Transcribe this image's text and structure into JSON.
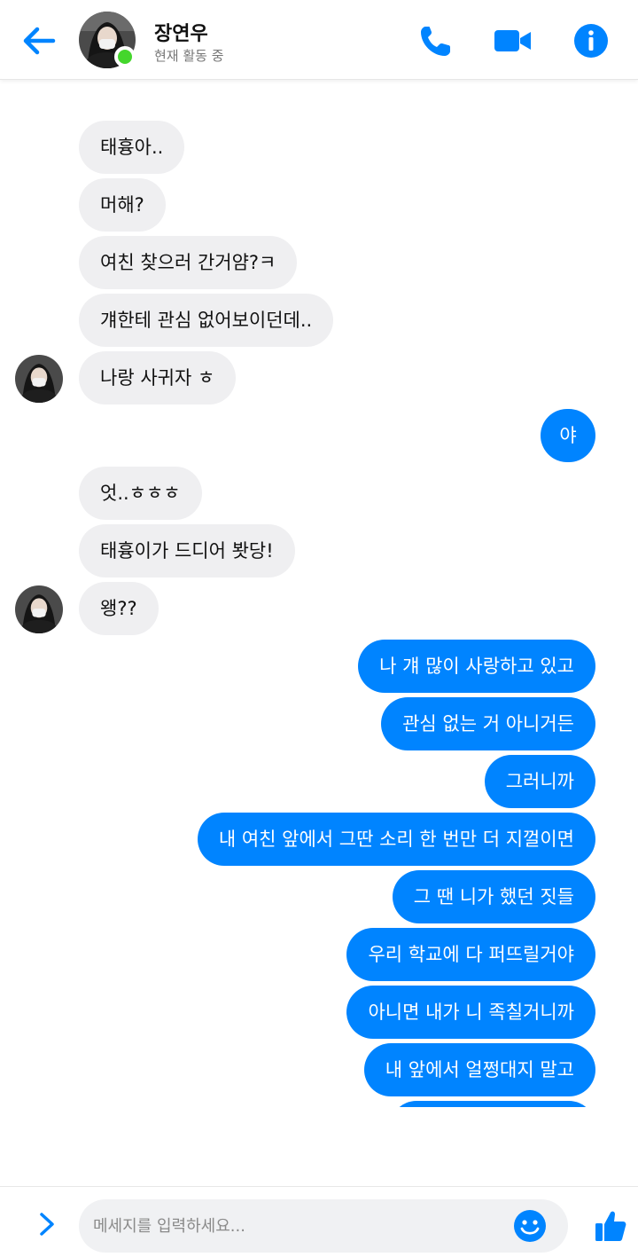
{
  "header": {
    "contact_name": "장연우",
    "status": "현재 활동 중",
    "icons": {
      "back": "arrow-left-icon",
      "call": "phone-icon",
      "video": "video-camera-icon",
      "info": "info-icon"
    },
    "colors": {
      "accent": "#0084ff",
      "online": "#44d62c"
    }
  },
  "messages": [
    {
      "sender": "them",
      "text": "태흉아.."
    },
    {
      "sender": "them",
      "text": "머해?"
    },
    {
      "sender": "them",
      "text": "여친 찾으러 간거얌?ㅋ"
    },
    {
      "sender": "them",
      "text": "걔한테 관심 없어보이던데.."
    },
    {
      "sender": "them",
      "text": "나랑 사귀자 ㅎ"
    },
    {
      "sender": "me",
      "text": "야"
    },
    {
      "sender": "them",
      "text": "엇..ㅎㅎㅎ"
    },
    {
      "sender": "them",
      "text": "태흉이가 드디어 봣당!"
    },
    {
      "sender": "them",
      "text": "왱??"
    },
    {
      "sender": "me",
      "text": "나 걔 많이 사랑하고 있고"
    },
    {
      "sender": "me",
      "text": "관심 없는 거 아니거든"
    },
    {
      "sender": "me",
      "text": "그러니까"
    },
    {
      "sender": "me",
      "text": "내 여친 앞에서 그딴 소리 한 번만 더 지껄이면"
    },
    {
      "sender": "me",
      "text": "그 땐 니가 했던 짓들"
    },
    {
      "sender": "me",
      "text": "우리 학교에 다 퍼뜨릴거야"
    },
    {
      "sender": "me",
      "text": "아니면 내가 니 족칠거니까"
    },
    {
      "sender": "me",
      "text": "내 앞에서 얼쩡대지 말고"
    },
    {
      "sender": "me",
      "text": ""
    }
  ],
  "composer": {
    "placeholder": "메세지를 입력하세요...",
    "icons": {
      "expand": "chevron-right-icon",
      "emoji": "emoji-icon",
      "like": "thumbs-up-icon"
    }
  },
  "colors": {
    "incoming_bubble": "#efeff1",
    "outgoing_bubble": "#0084ff"
  }
}
